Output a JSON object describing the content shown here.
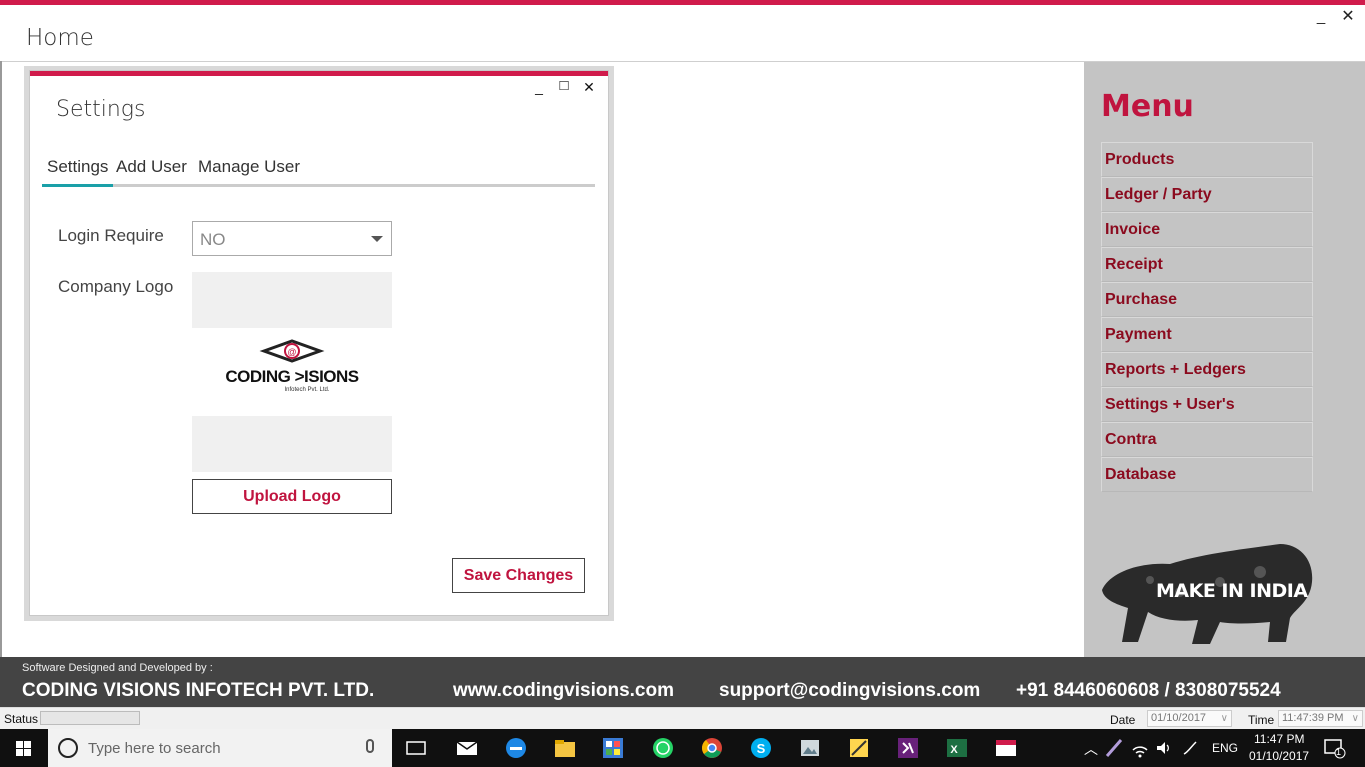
{
  "window": {
    "title": "Home",
    "minimize": "_",
    "close": "✕"
  },
  "dialog": {
    "title": "Settings",
    "minimize": "_",
    "maximize": "□",
    "close": "✕",
    "tabs": [
      {
        "label": "Settings",
        "active": true
      },
      {
        "label": "Add User",
        "active": false
      },
      {
        "label": "Manage User",
        "active": false
      }
    ],
    "login_require_label": "Login Require",
    "login_require_value": "NO",
    "company_logo_label": "Company Logo",
    "logo_text": "CODING >ISIONS",
    "logo_sub": "Infotech Pvt. Ltd.",
    "upload_button": "Upload Logo",
    "save_button": "Save Changes"
  },
  "menu": {
    "title": "Menu",
    "items": [
      "Products",
      "Ledger / Party",
      "Invoice",
      "Receipt",
      "Purchase",
      "Payment",
      "Reports + Ledgers",
      "Settings + User's",
      "Contra",
      "Database"
    ],
    "badge_text": "MAKE IN INDIA"
  },
  "footer": {
    "designed_by": "Software Designed and Developed by :",
    "company": "CODING VISIONS INFOTECH PVT. LTD.",
    "website": "www.codingvisions.com",
    "email": "support@codingvisions.com",
    "phone": "+91 8446060608 / 8308075524"
  },
  "statusbar": {
    "status_label": "Status",
    "date_label": "Date",
    "date_value": "01/10/2017",
    "time_label": "Time",
    "time_value": "11:47:39 PM"
  },
  "taskbar": {
    "search_placeholder": "Type here to search",
    "language": "ENG",
    "clock_time": "11:47 PM",
    "clock_date": "01/10/2017",
    "notification_count": "1"
  },
  "colors": {
    "accent": "#d01b4b",
    "menu_text": "#8b0a1e",
    "tab_active": "#1aa0a8"
  }
}
